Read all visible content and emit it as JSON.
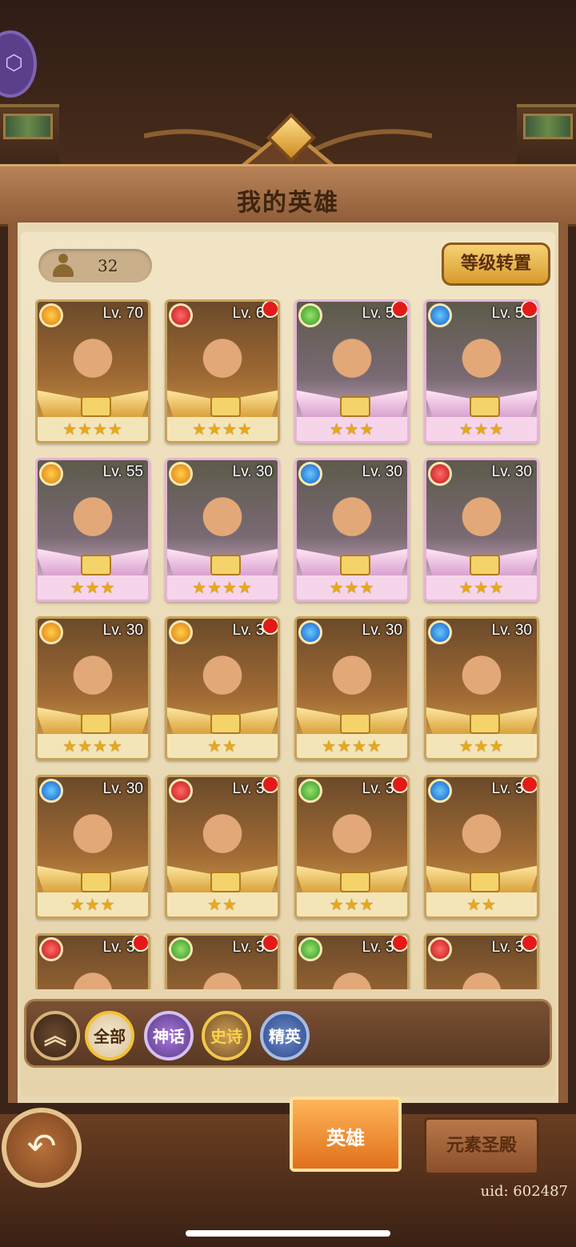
{
  "header": {
    "title": "我的英雄"
  },
  "hero_count": "32",
  "reset_button": "等级转置",
  "cards": [
    {
      "level": "Lv. 70",
      "element": "fire",
      "frame": "gold",
      "stars": "★★★★",
      "alert": false
    },
    {
      "level": "Lv. 60",
      "element": "red",
      "frame": "gold",
      "stars": "★★★★",
      "alert": true
    },
    {
      "level": "Lv. 55",
      "element": "green",
      "frame": "pink",
      "stars": "★★★",
      "alert": true
    },
    {
      "level": "Lv. 55",
      "element": "blue",
      "frame": "pink",
      "stars": "★★★",
      "alert": true
    },
    {
      "level": "Lv. 55",
      "element": "fire",
      "frame": "pink",
      "stars": "★★★",
      "alert": false
    },
    {
      "level": "Lv. 30",
      "element": "fire",
      "frame": "pink",
      "stars": "★★★★",
      "alert": false
    },
    {
      "level": "Lv. 30",
      "element": "blue",
      "frame": "pink",
      "stars": "★★★",
      "alert": false
    },
    {
      "level": "Lv. 30",
      "element": "red",
      "frame": "pink",
      "stars": "★★★",
      "alert": false
    },
    {
      "level": "Lv. 30",
      "element": "fire",
      "frame": "gold",
      "stars": "★★★★",
      "alert": false
    },
    {
      "level": "Lv. 30",
      "element": "fire",
      "frame": "gold",
      "stars": "★★",
      "alert": true
    },
    {
      "level": "Lv. 30",
      "element": "blue",
      "frame": "gold",
      "stars": "★★★★",
      "alert": false
    },
    {
      "level": "Lv. 30",
      "element": "blue",
      "frame": "gold",
      "stars": "★★★",
      "alert": false
    },
    {
      "level": "Lv. 30",
      "element": "blue",
      "frame": "gold",
      "stars": "★★★",
      "alert": false
    },
    {
      "level": "Lv. 30",
      "element": "red",
      "frame": "gold",
      "stars": "★★",
      "alert": true
    },
    {
      "level": "Lv. 30",
      "element": "green",
      "frame": "gold",
      "stars": "★★★",
      "alert": true
    },
    {
      "level": "Lv. 30",
      "element": "blue",
      "frame": "gold",
      "stars": "★★",
      "alert": true
    },
    {
      "level": "Lv. 30",
      "element": "red",
      "frame": "gold",
      "stars": "",
      "alert": true
    },
    {
      "level": "Lv. 30",
      "element": "green",
      "frame": "gold",
      "stars": "",
      "alert": true
    },
    {
      "level": "Lv. 30",
      "element": "green",
      "frame": "gold",
      "stars": "",
      "alert": true
    },
    {
      "level": "Lv. 30",
      "element": "red",
      "frame": "gold",
      "stars": "",
      "alert": true
    }
  ],
  "filters": {
    "all": "全部",
    "myth": "神话",
    "epic": "史诗",
    "elite": "精英"
  },
  "tabs": {
    "heroes": "英雄",
    "temple": "元素圣殿"
  },
  "uid": "uid: 602487",
  "icons": {
    "collapse": "chevrons-up-icon",
    "back": "back-arrow-icon",
    "count": "person-icon"
  }
}
